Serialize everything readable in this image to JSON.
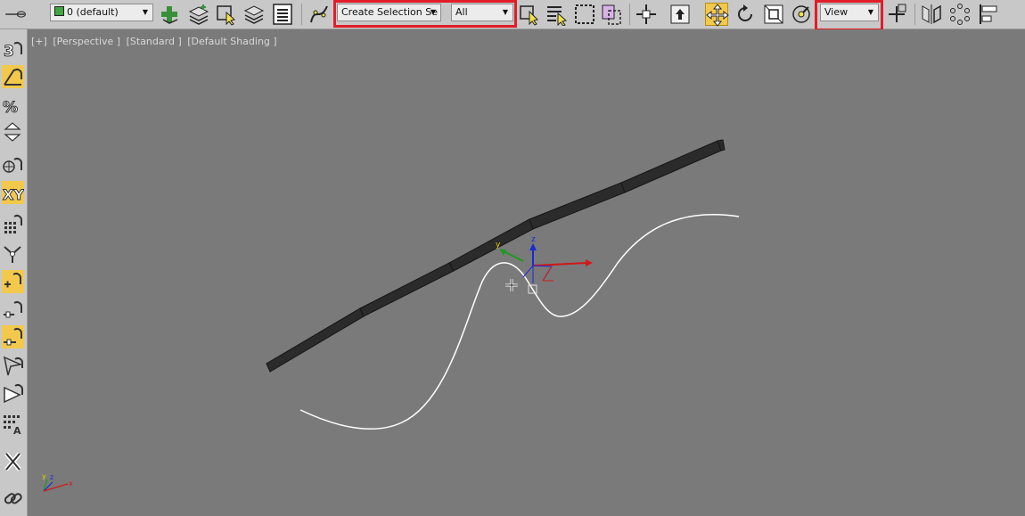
{
  "toolbar": {
    "layer_dropdown": {
      "value": "0 (default)"
    },
    "named_selection_dropdown": {
      "value": "Create Selection Se"
    },
    "selection_filter_dropdown": {
      "value": "All"
    },
    "reference_coord_dropdown": {
      "value": "View"
    },
    "highlight_color": "#e11d2a",
    "active_color": "#f2c94c"
  },
  "viewport": {
    "labels": [
      "[+]",
      "[Perspective ]",
      "[Standard ]",
      "[Default Shading ]"
    ],
    "gizmo_axes": {
      "x": "x",
      "y": "y",
      "z": "z"
    },
    "corner_axes": {
      "x": "x",
      "y": "y",
      "z": "z"
    },
    "colors": {
      "background": "#7a7a7a",
      "spline": "#ffffff",
      "object": "#2b2b2b",
      "axis_x": "#d01818",
      "axis_y": "#1c9a1c",
      "axis_z": "#1b2ad0"
    }
  },
  "icons": {
    "toolbar": [
      "layer-manager-icon",
      "create-layer-icon",
      "add-to-layer-icon",
      "select-object-icon",
      "layer-stack-icon",
      "scene-explorer-icon",
      "curve-editor-icon",
      "select-icon",
      "select-by-name-icon",
      "rect-selection-icon",
      "window-crossing-icon",
      "move-icon",
      "move-active-icon",
      "rotate-icon",
      "scale-icon",
      "pivot-icon",
      "mirror-icon",
      "align-icon",
      "array-icon"
    ],
    "sidebar": [
      "snap-3d-icon",
      "angle-snap-icon",
      "percent-snap-icon",
      "spinner-snap-icon",
      "edit-named-sel-icon",
      "mirror-axis-icon",
      "grid-icon",
      "bind-icon",
      "link-icon",
      "unlink-icon",
      "magnet-icon",
      "place-icon",
      "orient-icon",
      "auto-grid-icon",
      "close-icon",
      "chain-link-icon"
    ]
  }
}
